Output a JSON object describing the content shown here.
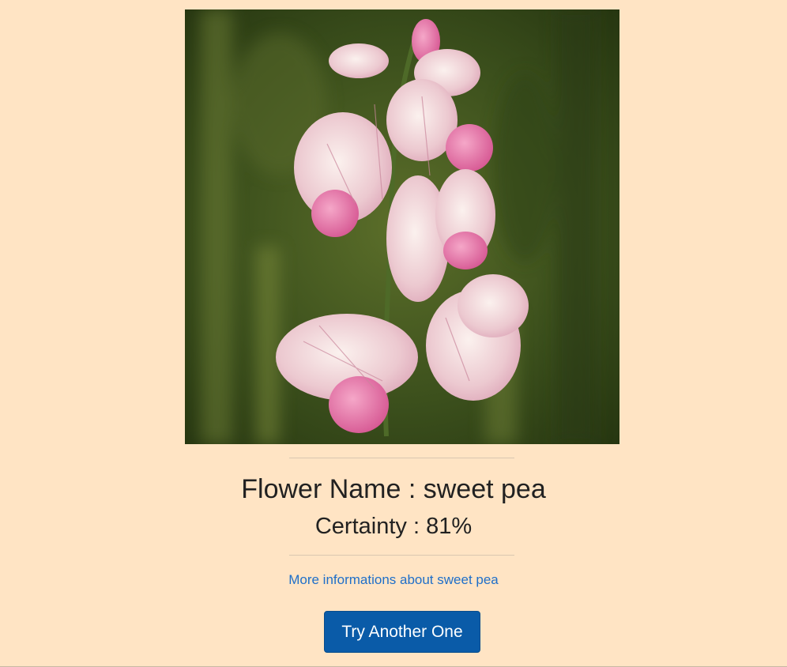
{
  "result": {
    "image_subject": "flower-photo",
    "title": "Flower Name : sweet pea",
    "certainty": "Certainty : 81%",
    "info_link": "More informations about sweet pea",
    "try_again_button": "Try Another One"
  },
  "colors": {
    "page_background": "#FFE4C4",
    "link": "#1f6fc9",
    "button_background": "#0a5ba8",
    "button_text": "#ffffff"
  }
}
